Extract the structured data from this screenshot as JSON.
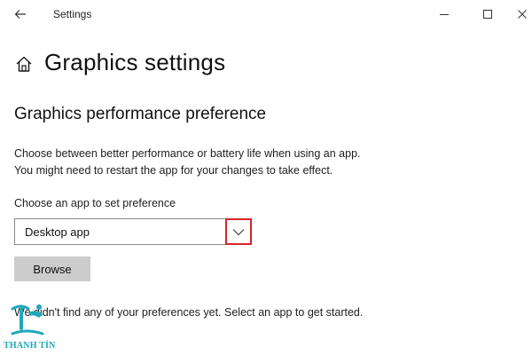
{
  "window": {
    "app_title": "Settings",
    "back_icon": "arrow-left-icon",
    "minimize_icon": "minimize-icon",
    "maximize_icon": "maximize-icon",
    "close_icon": "close-icon"
  },
  "header": {
    "home_icon": "home-icon",
    "title": "Graphics settings"
  },
  "section": {
    "title": "Graphics performance preference",
    "description_line1": "Choose between better performance or battery life when using an app.",
    "description_line2": "You might need to restart the app for your changes to take effect."
  },
  "app_selector": {
    "label": "Choose an app to set preference",
    "selected": "Desktop app",
    "chevron_icon": "chevron-down-icon",
    "highlight_color": "#d8242b"
  },
  "browse_button": {
    "label": "Browse"
  },
  "empty_state": {
    "message": "We didn't find any of your preferences yet. Select an app to get started."
  },
  "watermark": {
    "text": "THANH TÍN",
    "color": "#1fa8b8"
  },
  "colors": {
    "background": "#ffffff",
    "button_bg": "#cccccc",
    "dropdown_border": "#8a8a8a"
  }
}
